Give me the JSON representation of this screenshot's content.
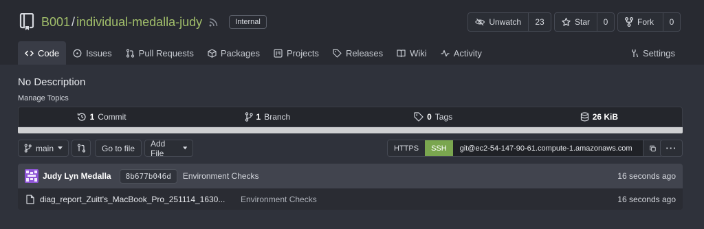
{
  "repo": {
    "owner": "B001",
    "separator": "/",
    "name": "individual-medalla-judy",
    "visibility_badge": "Internal"
  },
  "actions": {
    "unwatch": {
      "label": "Unwatch",
      "count": "23",
      "icon": "eye-slash-icon"
    },
    "star": {
      "label": "Star",
      "count": "0",
      "icon": "star-icon"
    },
    "fork": {
      "label": "Fork",
      "count": "0",
      "icon": "fork-icon"
    }
  },
  "tabs": [
    {
      "label": "Code",
      "icon": "code-icon",
      "active": true
    },
    {
      "label": "Issues",
      "icon": "issue-icon"
    },
    {
      "label": "Pull Requests",
      "icon": "pull-request-icon"
    },
    {
      "label": "Packages",
      "icon": "package-icon"
    },
    {
      "label": "Projects",
      "icon": "project-icon"
    },
    {
      "label": "Releases",
      "icon": "tag-icon"
    },
    {
      "label": "Wiki",
      "icon": "book-icon"
    },
    {
      "label": "Activity",
      "icon": "pulse-icon"
    }
  ],
  "settings_tab": {
    "label": "Settings",
    "icon": "tools-icon"
  },
  "description": "No Description",
  "manage_topics": "Manage Topics",
  "stats": {
    "commits": {
      "count": "1",
      "label": "Commit"
    },
    "branches": {
      "count": "1",
      "label": "Branch"
    },
    "tags": {
      "count": "0",
      "label": "Tags"
    },
    "size": {
      "count": "26 KiB",
      "label": ""
    }
  },
  "toolbar": {
    "branch": "main",
    "go_to_file": "Go to file",
    "add_file": "Add File"
  },
  "clone": {
    "https": "HTTPS",
    "ssh": "SSH",
    "url": "git@ec2-54-147-90-61.compute-1.amazonaws.com",
    "more": "···"
  },
  "latest_commit": {
    "author": "Judy Lyn Medalla",
    "sha": "8b677b046d",
    "message": "Environment Checks",
    "time": "16 seconds ago"
  },
  "files": [
    {
      "name": "diag_report_Zuitt's_MacBook_Pro_251114_1630...",
      "message": "Environment Checks",
      "time": "16 seconds ago"
    }
  ],
  "colors": {
    "accent_green": "#a2bf6b",
    "ssh_active": "#7aa64f",
    "background": "#2f323b",
    "header": "#282a31"
  }
}
